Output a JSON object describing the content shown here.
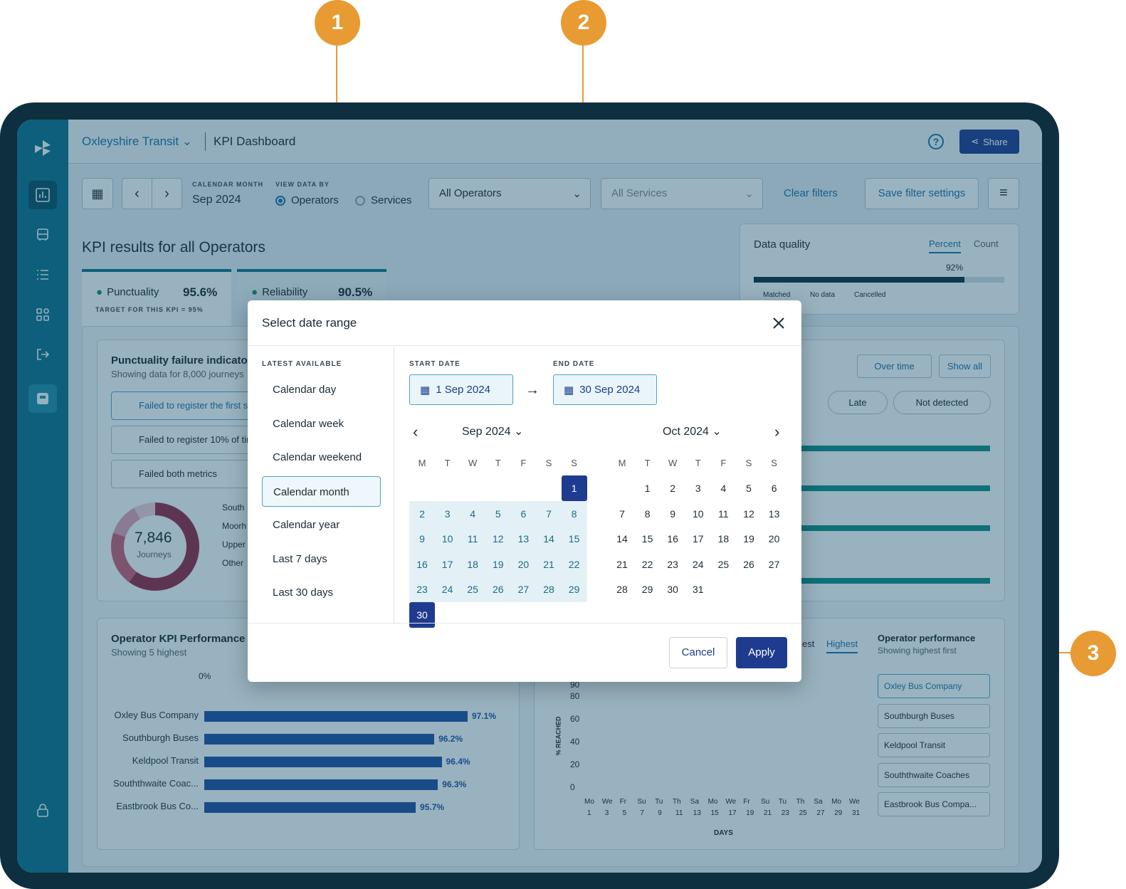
{
  "markers": [
    "1",
    "2",
    "3"
  ],
  "header": {
    "org": "Oxleyshire Transit",
    "title": "KPI Dashboard",
    "share": "Share"
  },
  "filters": {
    "calendar_month_label": "CALENDAR MONTH",
    "calendar_month_value": "Sep 2024",
    "view_by_label": "VIEW DATA BY",
    "view_options": [
      "Operators",
      "Services"
    ],
    "operators_select": "All Operators",
    "services_select": "All Services",
    "clear": "Clear filters",
    "save": "Save filter settings"
  },
  "page": {
    "title": "KPI results for all Operators"
  },
  "tabs": [
    {
      "label": "Punctuality",
      "value": "95.6%",
      "target": "TARGET FOR THIS KPI = 95%"
    },
    {
      "label": "Reliability",
      "value": "90.5%"
    }
  ],
  "data_quality": {
    "title": "Data quality",
    "tab_percent": "Percent",
    "tab_count": "Count",
    "value": "92%",
    "legend": [
      "Matched",
      "No data",
      "Cancelled"
    ]
  },
  "failure": {
    "title": "Punctuality failure indicato",
    "subtitle": "Showing data for 8,000 journeys",
    "items": [
      "Failed to register the first s",
      "Failed to register 10% of tin",
      "Failed both metrics"
    ],
    "total": "7,846",
    "total_label": "Journeys",
    "legend": [
      "South",
      "Moorh",
      "Upper",
      "Other"
    ]
  },
  "right_panel": {
    "over_time": "Over time",
    "show_all": "Show all",
    "pills": [
      "Late",
      "Not detected"
    ]
  },
  "operator_kpi": {
    "title": "Operator KPI Performance",
    "subtitle": "Showing 5 highest",
    "axis_zero": "0%",
    "rows": [
      {
        "name": "Oxley Bus Company",
        "value": "97.1%",
        "pct": 97.1
      },
      {
        "name": "Southburgh Buses",
        "value": "96.2%",
        "pct": 96.2
      },
      {
        "name": "Keldpool Transit",
        "value": "96.4%",
        "pct": 96.4
      },
      {
        "name": "Souththwaite Coac...",
        "value": "96.3%",
        "pct": 96.3
      },
      {
        "name": "Eastbrook Bus Co...",
        "value": "95.7%",
        "pct": 95.7
      }
    ]
  },
  "line_chart": {
    "tabs": [
      "est",
      "Highest"
    ],
    "ylabel": "% REACHED",
    "xlabel": "DAYS",
    "yticks": [
      "90",
      "80",
      "60",
      "40",
      "20",
      "0"
    ],
    "xdays": [
      "Mo",
      "We",
      "Fr",
      "Su",
      "Tu",
      "Th",
      "Sa",
      "Mo",
      "We",
      "Fr",
      "Su",
      "Tu",
      "Th",
      "Sa",
      "Mo",
      "We"
    ],
    "xnums": [
      "1",
      "3",
      "5",
      "7",
      "9",
      "11",
      "13",
      "15",
      "17",
      "19",
      "21",
      "23",
      "25",
      "27",
      "29",
      "31"
    ]
  },
  "op_perf": {
    "title": "Operator performance",
    "subtitle": "Showing highest first",
    "items": [
      "Oxley Bus Company",
      "Southburgh Buses",
      "Keldpool Transit",
      "Souththwaite Coaches",
      "Eastbrook Bus Compa..."
    ]
  },
  "dialog": {
    "title": "Select date range",
    "latest_label": "LATEST AVAILABLE",
    "presets": [
      "Calendar day",
      "Calendar week",
      "Calendar weekend",
      "Calendar month",
      "Calendar year",
      "Last 7 days",
      "Last 30 days"
    ],
    "start_label": "START DATE",
    "start_value": "1 Sep 2024",
    "end_label": "END DATE",
    "end_value": "30 Sep 2024",
    "month1": "Sep 2024",
    "month2": "Oct 2024",
    "dow": [
      "M",
      "T",
      "W",
      "T",
      "F",
      "S",
      "S"
    ],
    "cancel": "Cancel",
    "apply": "Apply"
  },
  "colors": {
    "accent": "#1f3b8f",
    "teal": "#0f6e8a",
    "marker": "#e89a33"
  }
}
